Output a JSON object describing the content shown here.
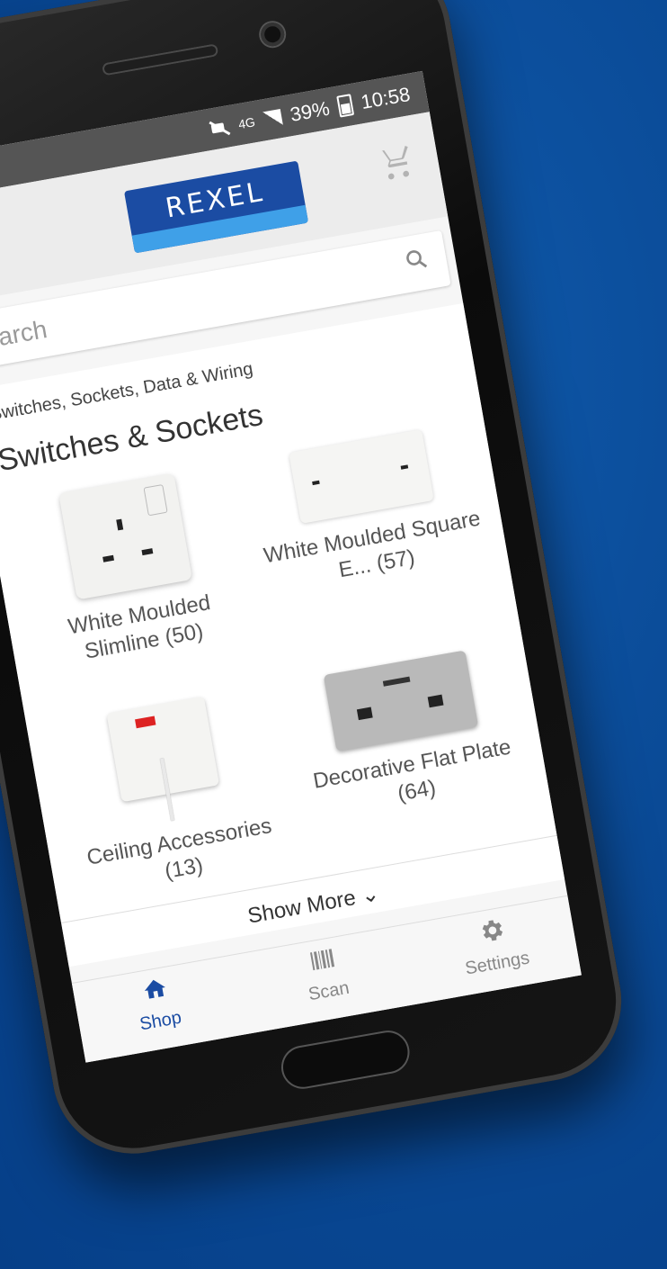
{
  "status_bar": {
    "network": "4G",
    "battery": "39%",
    "time": "10:58"
  },
  "header": {
    "logo_text": "REXEL"
  },
  "search": {
    "placeholder": "Search"
  },
  "breadcrumb": "Switches, Sockets, Data & Wiring",
  "section_title": "Switches & Sockets",
  "tiles": [
    {
      "label": "White Moulded Slimline (50)",
      "image": "white-single-socket"
    },
    {
      "label": "White Moulded Square E... (57)",
      "image": "white-double-socket"
    },
    {
      "label": "Ceiling Accessories (13)",
      "image": "ceiling-pull-switch"
    },
    {
      "label": "Decorative Flat Plate (64)",
      "image": "grey-double-socket-usb"
    }
  ],
  "show_more": "Show More",
  "bottom_nav": [
    {
      "label": "Shop",
      "icon": "home-icon",
      "active": true
    },
    {
      "label": "Scan",
      "icon": "barcode-icon",
      "active": false
    },
    {
      "label": "Settings",
      "icon": "gear-icon",
      "active": false
    }
  ],
  "colors": {
    "brand": "#1b4ca3",
    "background": "#0a4a96",
    "accent": "#3fa0e8"
  }
}
